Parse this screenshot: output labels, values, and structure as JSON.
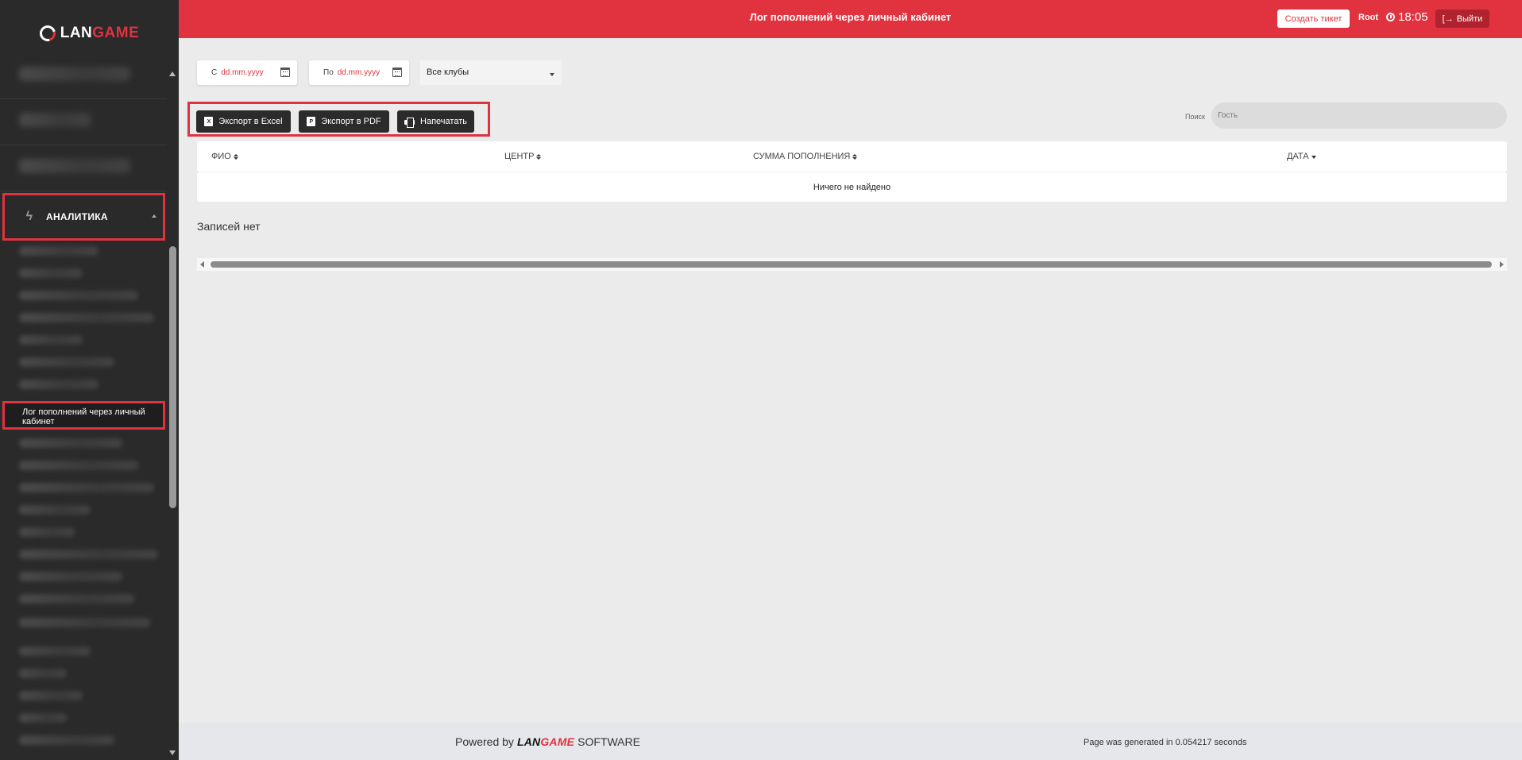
{
  "app": {
    "logo_prefix": "LAN",
    "logo_suffix": "GAME"
  },
  "header": {
    "title": "Лог пополнений через личный кабинет",
    "ticket_button": "Создать тикет",
    "user": "Root",
    "time": "18:05",
    "logout_button": "Выйти"
  },
  "sidebar": {
    "section_label": "АНАЛИТИКА",
    "active_item": "Лог пополнений через личный кабинет"
  },
  "filters": {
    "from_label": "С",
    "from_placeholder": "dd.mm.yyyy",
    "to_label": "По",
    "to_placeholder": "dd.mm.yyyy",
    "club_selected": "Все клубы"
  },
  "toolbar": {
    "export_excel": "Экспорт в Excel",
    "export_pdf": "Экспорт в PDF",
    "print": "Напечатать",
    "search_label": "Поиск",
    "search_placeholder": "Гость"
  },
  "table": {
    "columns": [
      "ФИО",
      "ЦЕНТР",
      "СУММА ПОПОЛНЕНИЯ",
      "ДАТА"
    ],
    "empty_message": "Ничего не найдено"
  },
  "records_info": "Записей нет",
  "footer": {
    "powered_by": "Powered by",
    "brand_prefix": "LAN",
    "brand_suffix": "GAME",
    "brand_software": "SOFTWARE",
    "generated": "Page was generated in 0.054217 seconds"
  },
  "colors": {
    "accent": "#e0323f",
    "sidebar_bg": "#2a2a2a",
    "page_bg": "#ebebeb"
  }
}
